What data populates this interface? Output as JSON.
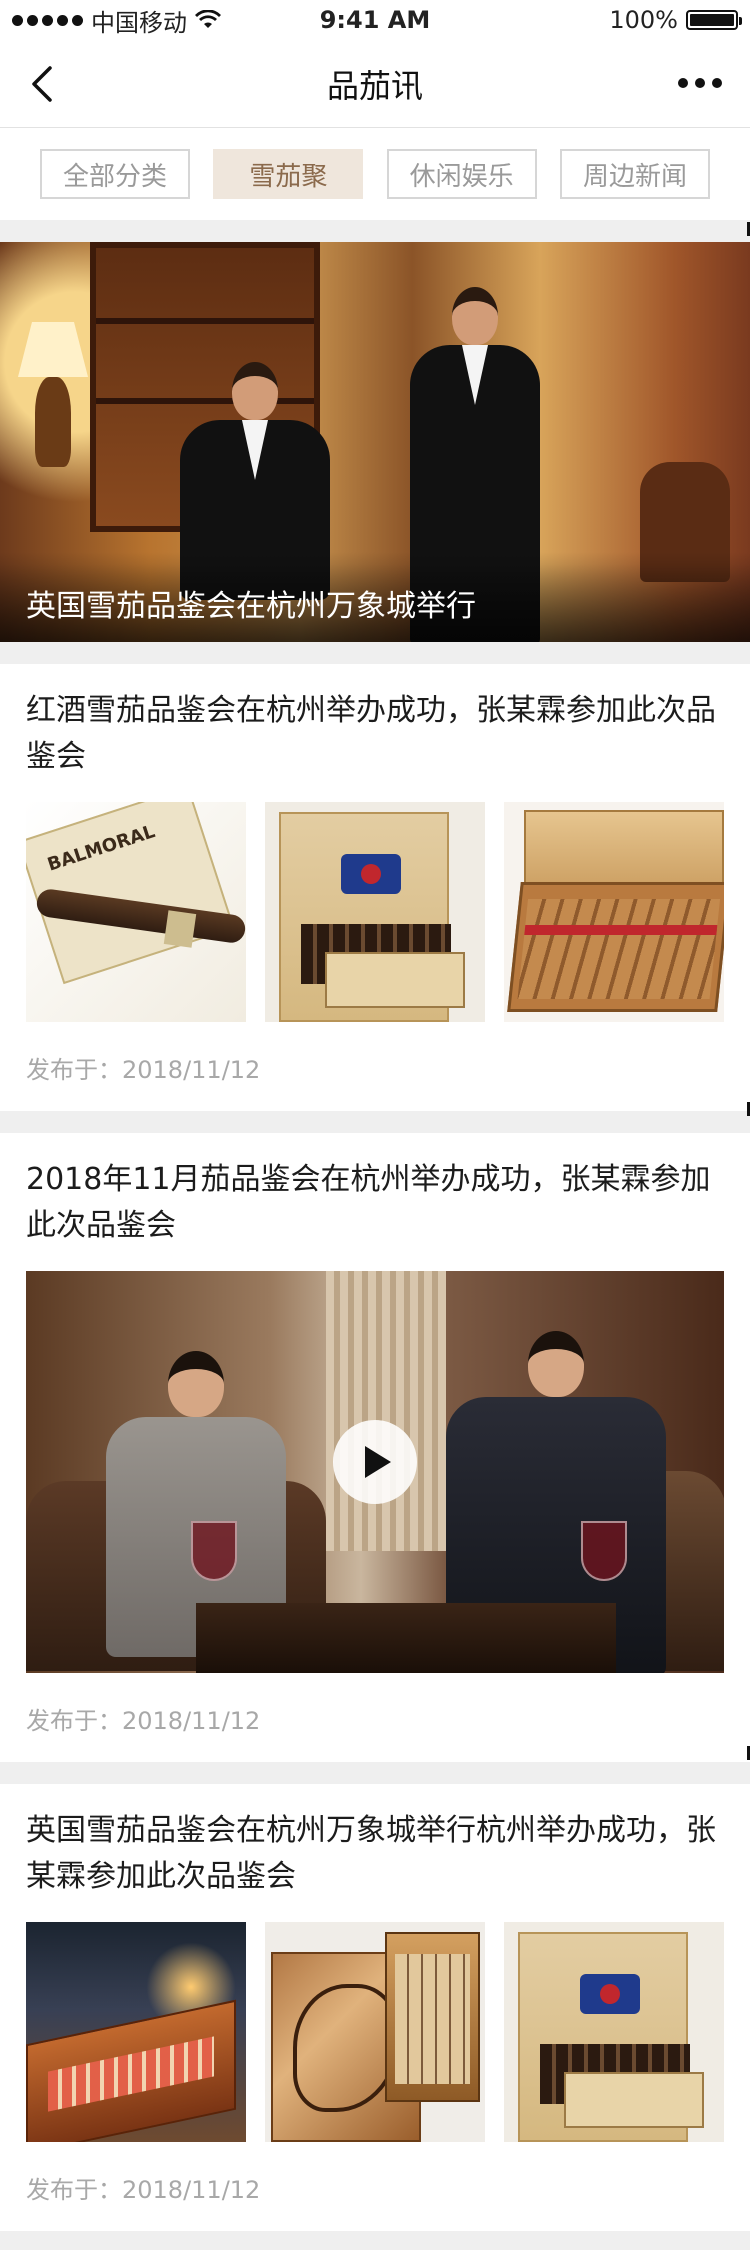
{
  "status_bar": {
    "carrier": "中国移动",
    "time": "9:41 AM",
    "battery_percent": "100%",
    "battery_level": 1.0,
    "wifi_icon": "wifi-icon",
    "signal_icon": "signal-dots-icon"
  },
  "nav": {
    "title": "品茄讯",
    "back_icon": "chevron-left-icon",
    "more_icon": "more-horizontal-icon"
  },
  "tabs": [
    {
      "label": "全部分类",
      "active": false
    },
    {
      "label": "雪茄聚",
      "active": true
    },
    {
      "label": "休闲娱乐",
      "active": false
    },
    {
      "label": "周边新闻",
      "active": false
    }
  ],
  "hero": {
    "caption": "英国雪茄品鉴会在杭州万象城举行"
  },
  "articles": [
    {
      "title": "红酒雪茄品鉴会在杭州举办成功，张某霖参加此次品鉴会",
      "published": "发布于：2018/11/12",
      "media": "images"
    },
    {
      "title": "2018年11月茄品鉴会在杭州举办成功，张某霖参加此次品鉴会",
      "published": "发布于：2018/11/12",
      "media": "video",
      "play_icon": "play-icon"
    },
    {
      "title": "英国雪茄品鉴会在杭州万象城举行杭州举办成功，张某霖参加此次品鉴会",
      "published": "发布于：2018/11/12",
      "media": "images"
    }
  ],
  "colors": {
    "active_tab_bg": "#efe6dc",
    "active_tab_text": "#8b6a4c",
    "meta_text": "#a8a8a8",
    "page_bg": "#efefef"
  }
}
